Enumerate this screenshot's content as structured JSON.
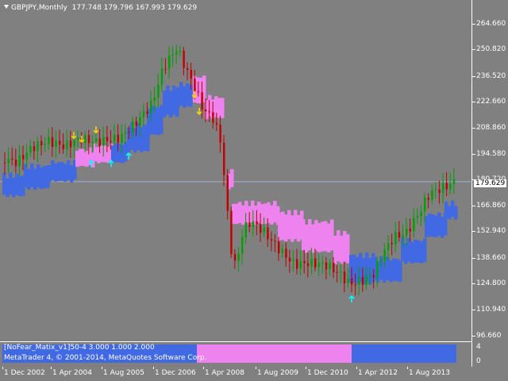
{
  "header": {
    "symbol": "GBPJPY,Monthly",
    "ohlc": "177.748 179.796 167.993 179.629"
  },
  "price_axis": {
    "labels": [
      "264.660",
      "250.820",
      "236.520",
      "222.660",
      "208.860",
      "194.580",
      "180.720",
      "166.860",
      "152.940",
      "138.660",
      "124.800",
      "110.940",
      "96.660"
    ],
    "values": [
      264.66,
      250.82,
      236.52,
      222.66,
      208.86,
      194.58,
      180.72,
      166.86,
      152.94,
      138.66,
      124.8,
      110.94,
      96.66
    ],
    "current": "179.629"
  },
  "indicator": {
    "label": "[NoFear_Matix_v1]50-4 3.000 1.000 2.000",
    "scale_top": "4",
    "scale_bottom": "0"
  },
  "copyright": "MetaTrader 4, © 2001-2014, MetaQuotes Software Corp.",
  "time_axis": {
    "labels": [
      "1 Dec 2002",
      "1 Apr 2004",
      "1 Aug 2005",
      "1 Dec 2006",
      "1 Apr 2008",
      "1 Aug 2009",
      "1 Dec 2010",
      "1 Apr 2012",
      "1 Aug 2013"
    ]
  },
  "colors": {
    "background": "#808080",
    "bull_candle": "#00a000",
    "bear_candle": "#c00000",
    "band_blue": "#4169e1",
    "band_pink": "#ee82ee",
    "arrow_down": "#ffd700",
    "arrow_up": "#00ffff"
  },
  "chart_data": {
    "type": "candlestick",
    "timeframe": "Monthly",
    "x_range": [
      "2002-12",
      "2014-03"
    ],
    "ylim": [
      96.66,
      272.0
    ],
    "approx_close_path": [
      {
        "x": "2002-12",
        "y": 190
      },
      {
        "x": "2003-06",
        "y": 188
      },
      {
        "x": "2004-01",
        "y": 196
      },
      {
        "x": "2004-06",
        "y": 198
      },
      {
        "x": "2005-01",
        "y": 196
      },
      {
        "x": "2005-08",
        "y": 198
      },
      {
        "x": "2006-01",
        "y": 206
      },
      {
        "x": "2006-08",
        "y": 218
      },
      {
        "x": "2007-03",
        "y": 238
      },
      {
        "x": "2007-07",
        "y": 248
      },
      {
        "x": "2007-12",
        "y": 226
      },
      {
        "x": "2008-06",
        "y": 208
      },
      {
        "x": "2008-10",
        "y": 150
      },
      {
        "x": "2009-01",
        "y": 130
      },
      {
        "x": "2009-06",
        "y": 152
      },
      {
        "x": "2010-01",
        "y": 148
      },
      {
        "x": "2010-08",
        "y": 132
      },
      {
        "x": "2011-03",
        "y": 132
      },
      {
        "x": "2011-10",
        "y": 120
      },
      {
        "x": "2012-06",
        "y": 124
      },
      {
        "x": "2013-01",
        "y": 142
      },
      {
        "x": "2013-06",
        "y": 152
      },
      {
        "x": "2013-12",
        "y": 170
      },
      {
        "x": "2014-03",
        "y": 179.6
      }
    ]
  }
}
